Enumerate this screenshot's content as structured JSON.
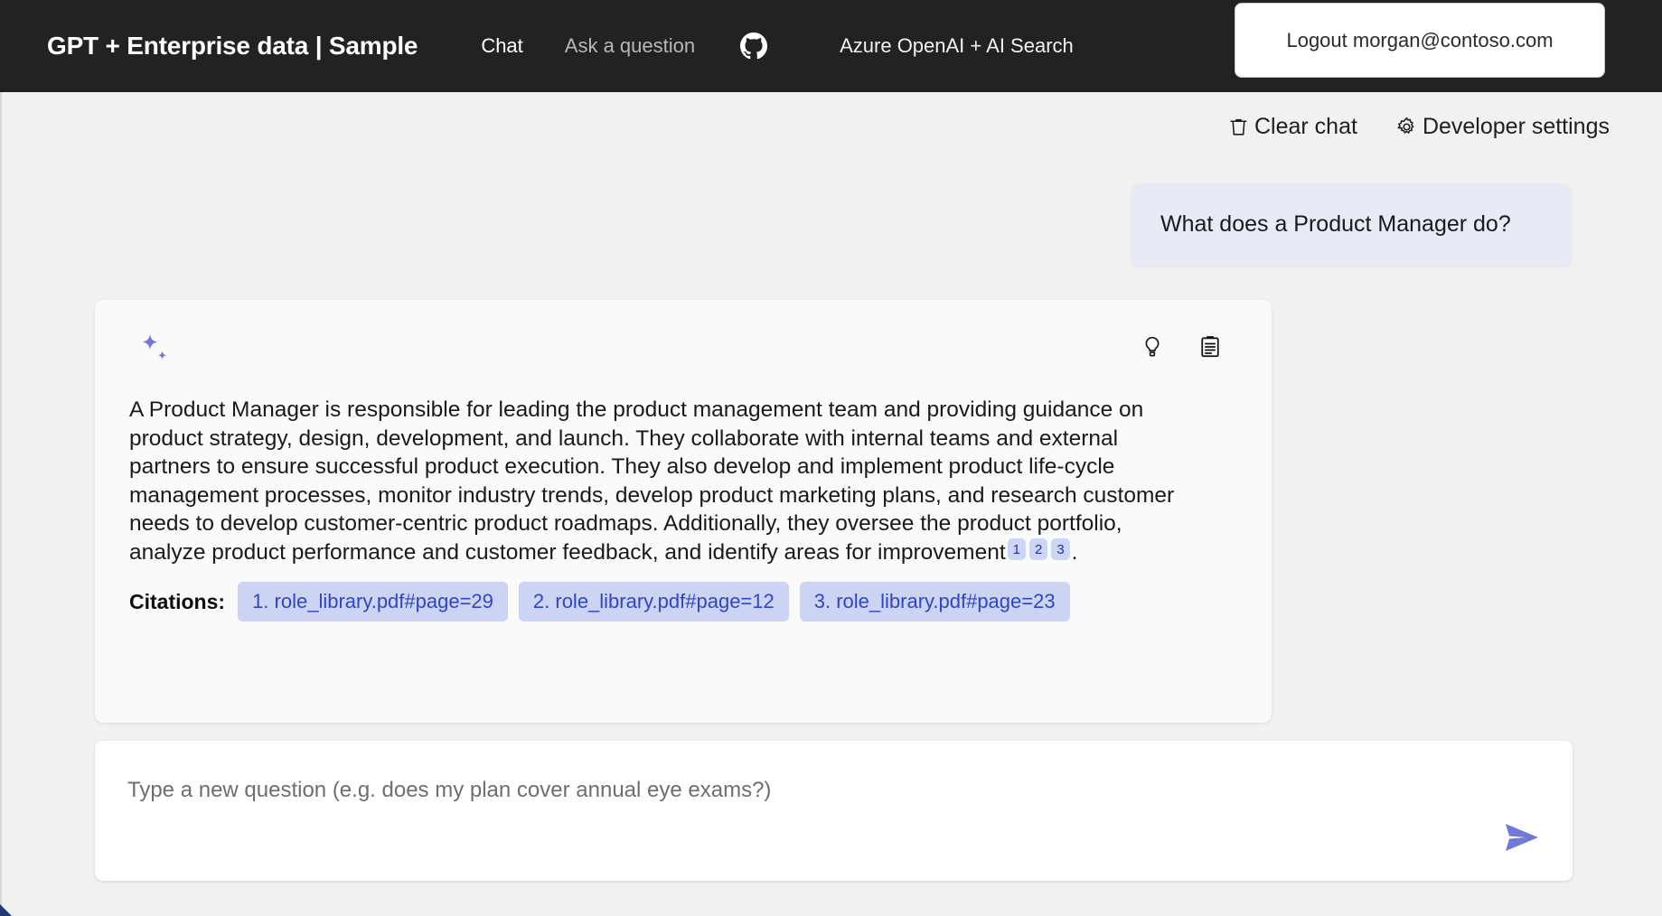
{
  "header": {
    "title": "GPT + Enterprise data | Sample",
    "nav": [
      {
        "label": "Chat",
        "active": true
      },
      {
        "label": "Ask a question",
        "active": false
      }
    ],
    "github_icon": "github-icon",
    "subtitle": "Azure OpenAI + AI Search",
    "logout_label": "Logout morgan@contoso.com",
    "background_color": "#222222"
  },
  "command_bar": {
    "clear_chat": {
      "label": "Clear chat",
      "icon": "trash-icon"
    },
    "developer_settings": {
      "label": "Developer settings",
      "icon": "gear-icon"
    }
  },
  "conversation": {
    "user_message": "What does a Product Manager do?",
    "answer": {
      "avatar_icon": "sparkle-icon",
      "actions": [
        {
          "name": "thought-process",
          "icon": "lightbulb-icon"
        },
        {
          "name": "supporting-content",
          "icon": "clipboard-icon"
        }
      ],
      "text_part_1": "A Product Manager is responsible for leading the product management team and providing guidance on product strategy, design, development, and launch. They collaborate with internal teams and external partners to ensure successful product execution. They also develop and implement product life-cycle management processes, monitor industry trends, develop product marketing plans, and research customer needs to develop customer-centric product roadmaps. Additionally, they oversee the product portfolio, analyze product performance and customer feedback, and identify areas for improvement",
      "inline_citations": [
        "1",
        "2",
        "3"
      ],
      "text_part_2": ".",
      "citations_label": "Citations:",
      "citations": [
        "1. role_library.pdf#page=29",
        "2. role_library.pdf#page=12",
        "3. role_library.pdf#page=23"
      ]
    }
  },
  "question_input": {
    "value": "",
    "placeholder": "Type a new question (e.g. does my plan cover annual eye exams?)",
    "send_icon": "send-icon"
  },
  "colors": {
    "accent_purple": "#7178d6",
    "citation_bg": "#ccd3f3",
    "citation_text": "#2f46c4",
    "user_bubble_bg": "#e8eaf6",
    "page_bg": "#f1f1f1",
    "card_bg": "#fafafa"
  }
}
